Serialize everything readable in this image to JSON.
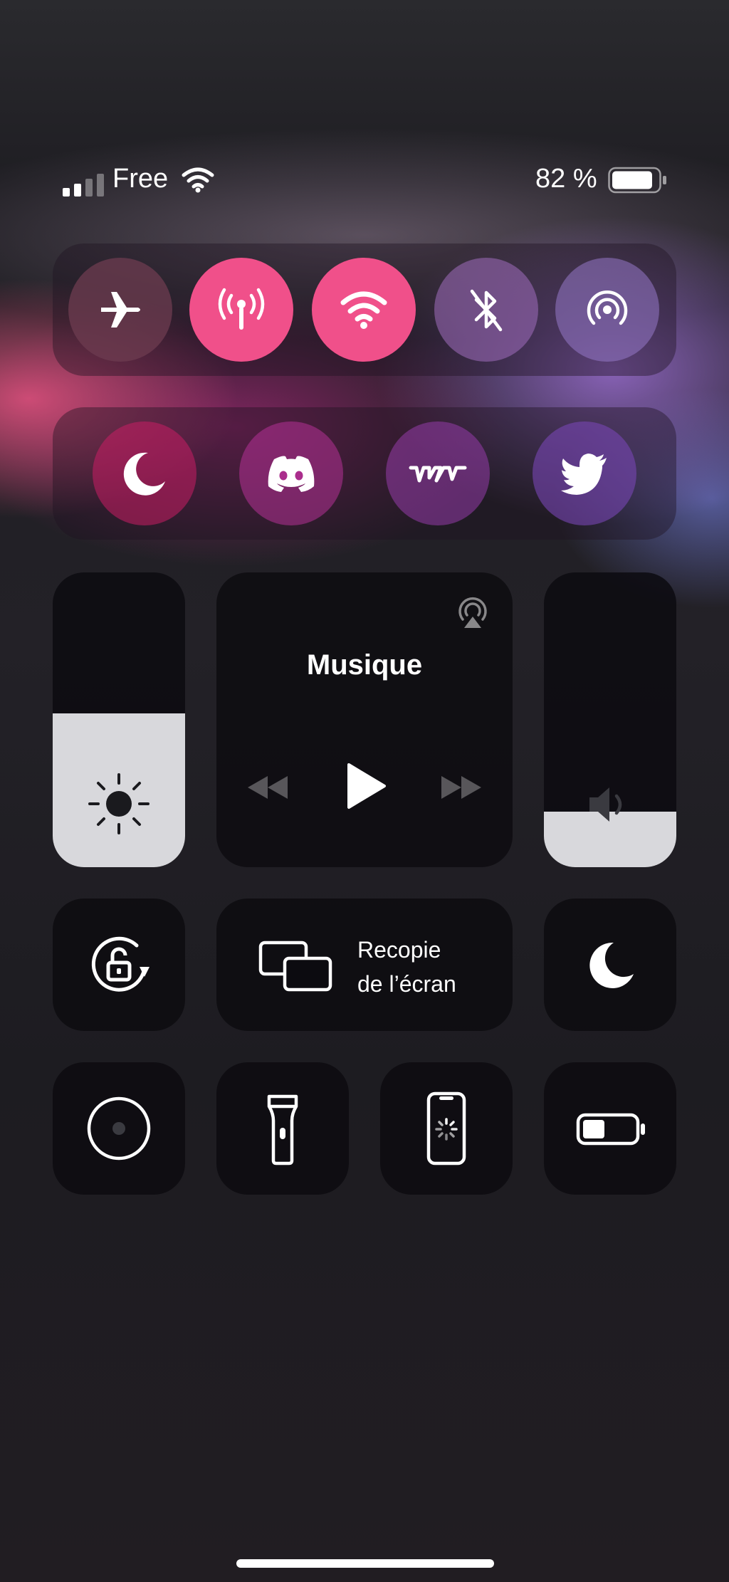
{
  "status_bar": {
    "carrier": "Free",
    "battery_percent": "82 %",
    "signal_bars_active": 2,
    "battery_level": 0.82
  },
  "connectivity": {
    "buttons": [
      {
        "name": "airplane-mode",
        "icon": "airplane-icon",
        "active": false
      },
      {
        "name": "cellular-data",
        "icon": "antenna-icon",
        "active": true
      },
      {
        "name": "wifi",
        "icon": "wifi-icon",
        "active": true
      },
      {
        "name": "bluetooth",
        "icon": "bluetooth-off-icon",
        "active": false
      },
      {
        "name": "personal-hotspot",
        "icon": "hotspot-icon",
        "active": false
      }
    ]
  },
  "shortcuts": {
    "buttons": [
      {
        "name": "do-not-disturb",
        "icon": "moon-icon"
      },
      {
        "name": "discord",
        "icon": "discord-icon"
      },
      {
        "name": "vj",
        "icon": "vj-icon"
      },
      {
        "name": "twitter",
        "icon": "twitter-icon"
      }
    ]
  },
  "brightness": {
    "level": 0.52,
    "icon": "sun-icon"
  },
  "volume": {
    "level": 0.19,
    "icon": "speaker-icon"
  },
  "music": {
    "title": "Musique",
    "airplay_icon": "airplay-icon",
    "controls": [
      "rewind-icon",
      "play-icon",
      "fast-forward-icon"
    ]
  },
  "screen_mirroring": {
    "label_line1": "Recopie",
    "label_line2": "de l’écran",
    "icon": "screen-mirroring-icon"
  },
  "bottom_row": {
    "items": [
      "orientation-lock-icon",
      "moon-icon",
      "screen-record-icon",
      "flashlight-icon",
      "screen-recording-phone-icon",
      "low-power-battery-icon"
    ]
  },
  "colors": {
    "accent_pink": "#f0508a",
    "tile_dark": "#0c0b10",
    "slider_fill": "#d8d8dc"
  }
}
